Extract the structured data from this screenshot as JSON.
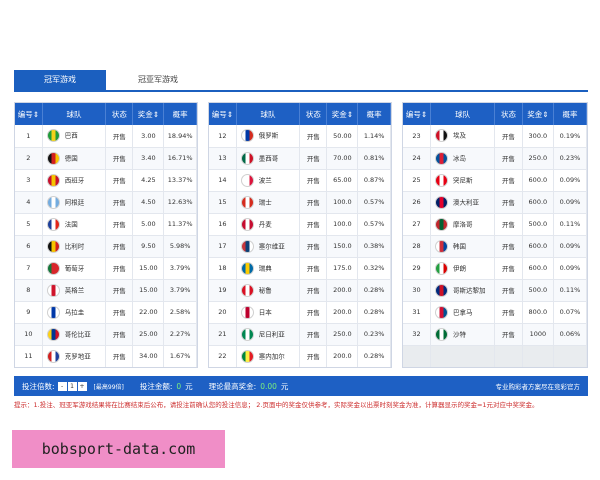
{
  "tabs": [
    {
      "label": "冠军游戏",
      "active": true
    },
    {
      "label": "冠亚军游戏",
      "active": false
    }
  ],
  "columns": [
    "编号⇕",
    "球队",
    "状态",
    "奖金⇕",
    "概率"
  ],
  "accent_color": "#1e60c4",
  "table1": [
    {
      "no": "1",
      "team": "巴西",
      "status": "开售",
      "prize": "3.00",
      "prob": "18.94%",
      "flag": "brazil-flag-icon",
      "colors": [
        "#1f9b3a",
        "#f3d11a",
        "#1f9b3a"
      ]
    },
    {
      "no": "2",
      "team": "德国",
      "status": "开售",
      "prize": "3.40",
      "prob": "16.71%",
      "flag": "germany-flag-icon",
      "colors": [
        "#111111",
        "#d21f1f",
        "#f5c400"
      ]
    },
    {
      "no": "3",
      "team": "西班牙",
      "status": "开售",
      "prize": "4.25",
      "prob": "13.37%",
      "flag": "spain-flag-icon",
      "colors": [
        "#c8102e",
        "#f4c300",
        "#c8102e"
      ]
    },
    {
      "no": "4",
      "team": "阿根廷",
      "status": "开售",
      "prize": "4.50",
      "prob": "12.63%",
      "flag": "argentina-flag-icon",
      "colors": [
        "#74acdf",
        "#ffffff",
        "#74acdf"
      ]
    },
    {
      "no": "5",
      "team": "法国",
      "status": "开售",
      "prize": "5.00",
      "prob": "11.37%",
      "flag": "france-flag-icon",
      "colors": [
        "#1d3f9a",
        "#ffffff",
        "#e1251b"
      ]
    },
    {
      "no": "6",
      "team": "比利时",
      "status": "开售",
      "prize": "9.50",
      "prob": "5.98%",
      "flag": "belgium-flag-icon",
      "colors": [
        "#111111",
        "#f5c400",
        "#d21f1f"
      ]
    },
    {
      "no": "7",
      "team": "葡萄牙",
      "status": "开售",
      "prize": "15.00",
      "prob": "3.79%",
      "flag": "portugal-flag-icon",
      "colors": [
        "#14773a",
        "#d8262b",
        "#d8262b"
      ]
    },
    {
      "no": "8",
      "team": "英格兰",
      "status": "开售",
      "prize": "15.00",
      "prob": "3.79%",
      "flag": "england-flag-icon",
      "colors": [
        "#ffffff",
        "#cf142b",
        "#ffffff"
      ]
    },
    {
      "no": "9",
      "team": "乌拉圭",
      "status": "开售",
      "prize": "22.00",
      "prob": "2.58%",
      "flag": "uruguay-flag-icon",
      "colors": [
        "#ffffff",
        "#0038a8",
        "#ffffff"
      ]
    },
    {
      "no": "10",
      "team": "哥伦比亚",
      "status": "开售",
      "prize": "25.00",
      "prob": "2.27%",
      "flag": "colombia-flag-icon",
      "colors": [
        "#fcd116",
        "#003893",
        "#ce1126"
      ]
    },
    {
      "no": "11",
      "team": "克罗地亚",
      "status": "开售",
      "prize": "34.00",
      "prob": "1.67%",
      "flag": "croatia-flag-icon",
      "colors": [
        "#d21f1f",
        "#ffffff",
        "#1d3f9a"
      ]
    }
  ],
  "table2": [
    {
      "no": "12",
      "team": "俄罗斯",
      "status": "开售",
      "prize": "50.00",
      "prob": "1.14%",
      "flag": "russia-flag-icon",
      "colors": [
        "#ffffff",
        "#0039a6",
        "#d52b1e"
      ]
    },
    {
      "no": "13",
      "team": "墨西哥",
      "status": "开售",
      "prize": "70.00",
      "prob": "0.81%",
      "flag": "mexico-flag-icon",
      "colors": [
        "#006847",
        "#ffffff",
        "#ce1126"
      ]
    },
    {
      "no": "14",
      "team": "波兰",
      "status": "开售",
      "prize": "65.00",
      "prob": "0.87%",
      "flag": "poland-flag-icon",
      "colors": [
        "#ffffff",
        "#ffffff",
        "#dc143c"
      ]
    },
    {
      "no": "15",
      "team": "瑞士",
      "status": "开售",
      "prize": "100.0",
      "prob": "0.57%",
      "flag": "switzerland-flag-icon",
      "colors": [
        "#d52b1e",
        "#ffffff",
        "#d52b1e"
      ]
    },
    {
      "no": "16",
      "team": "丹麦",
      "status": "开售",
      "prize": "100.0",
      "prob": "0.57%",
      "flag": "denmark-flag-icon",
      "colors": [
        "#c60c30",
        "#ffffff",
        "#c60c30"
      ]
    },
    {
      "no": "17",
      "team": "塞尔维亚",
      "status": "开售",
      "prize": "150.0",
      "prob": "0.38%",
      "flag": "serbia-flag-icon",
      "colors": [
        "#c6363c",
        "#0c4076",
        "#ffffff"
      ]
    },
    {
      "no": "18",
      "team": "瑞典",
      "status": "开售",
      "prize": "175.0",
      "prob": "0.32%",
      "flag": "sweden-flag-icon",
      "colors": [
        "#006aa7",
        "#fecc00",
        "#006aa7"
      ]
    },
    {
      "no": "19",
      "team": "秘鲁",
      "status": "开售",
      "prize": "200.0",
      "prob": "0.28%",
      "flag": "peru-flag-icon",
      "colors": [
        "#d91023",
        "#ffffff",
        "#d91023"
      ]
    },
    {
      "no": "20",
      "team": "日本",
      "status": "开售",
      "prize": "200.0",
      "prob": "0.28%",
      "flag": "japan-flag-icon",
      "colors": [
        "#ffffff",
        "#bc002d",
        "#ffffff"
      ]
    },
    {
      "no": "21",
      "team": "尼日利亚",
      "status": "开售",
      "prize": "250.0",
      "prob": "0.23%",
      "flag": "nigeria-flag-icon",
      "colors": [
        "#008751",
        "#ffffff",
        "#008751"
      ]
    },
    {
      "no": "22",
      "team": "塞内加尔",
      "status": "开售",
      "prize": "200.0",
      "prob": "0.28%",
      "flag": "senegal-flag-icon",
      "colors": [
        "#00853f",
        "#fdef42",
        "#e31b23"
      ]
    }
  ],
  "table3": [
    {
      "no": "23",
      "team": "埃及",
      "status": "开售",
      "prize": "300.0",
      "prob": "0.19%",
      "flag": "egypt-flag-icon",
      "colors": [
        "#ce1126",
        "#ffffff",
        "#111111"
      ]
    },
    {
      "no": "24",
      "team": "冰岛",
      "status": "开售",
      "prize": "250.0",
      "prob": "0.23%",
      "flag": "iceland-flag-icon",
      "colors": [
        "#02529c",
        "#dc1e35",
        "#02529c"
      ]
    },
    {
      "no": "25",
      "team": "突尼斯",
      "status": "开售",
      "prize": "600.0",
      "prob": "0.09%",
      "flag": "tunisia-flag-icon",
      "colors": [
        "#e70013",
        "#ffffff",
        "#e70013"
      ]
    },
    {
      "no": "26",
      "team": "澳大利亚",
      "status": "开售",
      "prize": "600.0",
      "prob": "0.09%",
      "flag": "australia-flag-icon",
      "colors": [
        "#012169",
        "#e4002b",
        "#012169"
      ]
    },
    {
      "no": "27",
      "team": "摩洛哥",
      "status": "开售",
      "prize": "500.0",
      "prob": "0.11%",
      "flag": "morocco-flag-icon",
      "colors": [
        "#c1272d",
        "#006233",
        "#c1272d"
      ]
    },
    {
      "no": "28",
      "team": "韩国",
      "status": "开售",
      "prize": "600.0",
      "prob": "0.09%",
      "flag": "korea-flag-icon",
      "colors": [
        "#ffffff",
        "#cd2e3a",
        "#0047a0"
      ]
    },
    {
      "no": "29",
      "team": "伊朗",
      "status": "开售",
      "prize": "600.0",
      "prob": "0.09%",
      "flag": "iran-flag-icon",
      "colors": [
        "#239f40",
        "#ffffff",
        "#da0000"
      ]
    },
    {
      "no": "30",
      "team": "哥斯达黎加",
      "status": "开售",
      "prize": "500.0",
      "prob": "0.11%",
      "flag": "costa-rica-flag-icon",
      "colors": [
        "#002b7f",
        "#ce1126",
        "#002b7f"
      ]
    },
    {
      "no": "31",
      "team": "巴拿马",
      "status": "开售",
      "prize": "800.0",
      "prob": "0.07%",
      "flag": "panama-flag-icon",
      "colors": [
        "#ffffff",
        "#d21034",
        "#005293"
      ]
    },
    {
      "no": "32",
      "team": "沙特",
      "status": "开售",
      "prize": "1000",
      "prob": "0.06%",
      "flag": "saudi-flag-icon",
      "colors": [
        "#006c35",
        "#ffffff",
        "#006c35"
      ]
    }
  ],
  "footer": {
    "multiplier_label": "投注倍数:",
    "minus": "-",
    "multiplier_value": "1",
    "plus": "+",
    "multiplier_hint": "[最高99倍]",
    "amount_label": "投注金额:",
    "amount_value": "0",
    "amount_unit": "元",
    "max_prize_label": "理论最高奖金:",
    "max_prize_value": "0.00",
    "max_prize_unit": "元",
    "right_text": "专业购彩者方案尽在竞彩官方"
  },
  "notes_text": "提示：1.投注、冠亚军游戏结果将在比赛结束后公布，请投注前确认您的投注信息；  2.页面中的奖金仅供参考，实际奖金以出票时刻奖金为准，计算器显示的奖金=1元对应中奖奖金。",
  "watermark": "bobsport-data.com"
}
